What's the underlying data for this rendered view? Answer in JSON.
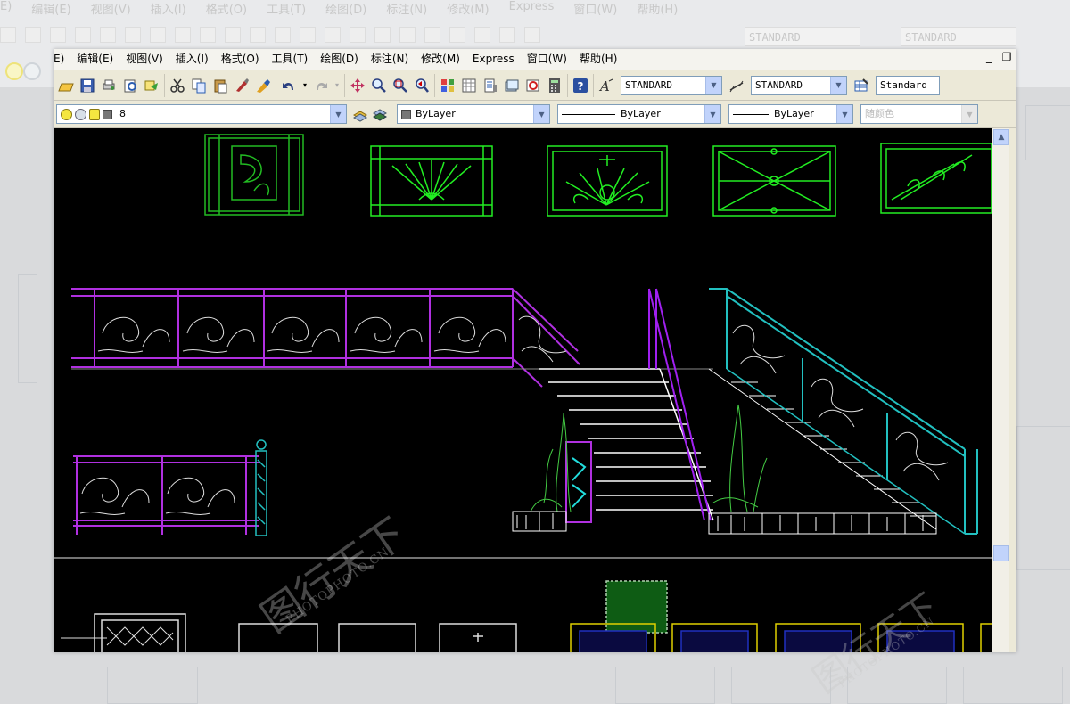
{
  "menu": [
    "E)",
    "编辑(E)",
    "视图(V)",
    "插入(I)",
    "格式(O)",
    "工具(T)",
    "绘图(D)",
    "标注(N)",
    "修改(M)",
    "Express",
    "窗口(W)",
    "帮助(H)"
  ],
  "bg_menu": [
    "E)",
    "编辑(E)",
    "视图(V)",
    "插入(I)",
    "格式(O)",
    "工具(T)",
    "绘图(D)",
    "标注(N)",
    "修改(M)",
    "Express",
    "窗口(W)",
    "帮助(H)"
  ],
  "styles": {
    "text_style": "STANDARD",
    "dim_style": "STANDARD",
    "table_style": "Standard"
  },
  "layer": {
    "current": "8",
    "color_control": "ByLayer",
    "linetype_control": "ByLayer",
    "lineweight_control": "ByLayer",
    "plot_style": "随颜色"
  },
  "window_controls": {
    "minimize": "_",
    "restore": "❐"
  },
  "watermark": {
    "text": "图行天下",
    "url": "PHOTOPHOTO.CN"
  },
  "colors": {
    "canvas": "#000000",
    "green_panels": "#00e600",
    "magenta_rail": "#a020f0",
    "cyan_rail": "#20c0c0",
    "stairs": "#ffffff",
    "plants": "#44cc44",
    "window_frames": "#e0d000"
  }
}
